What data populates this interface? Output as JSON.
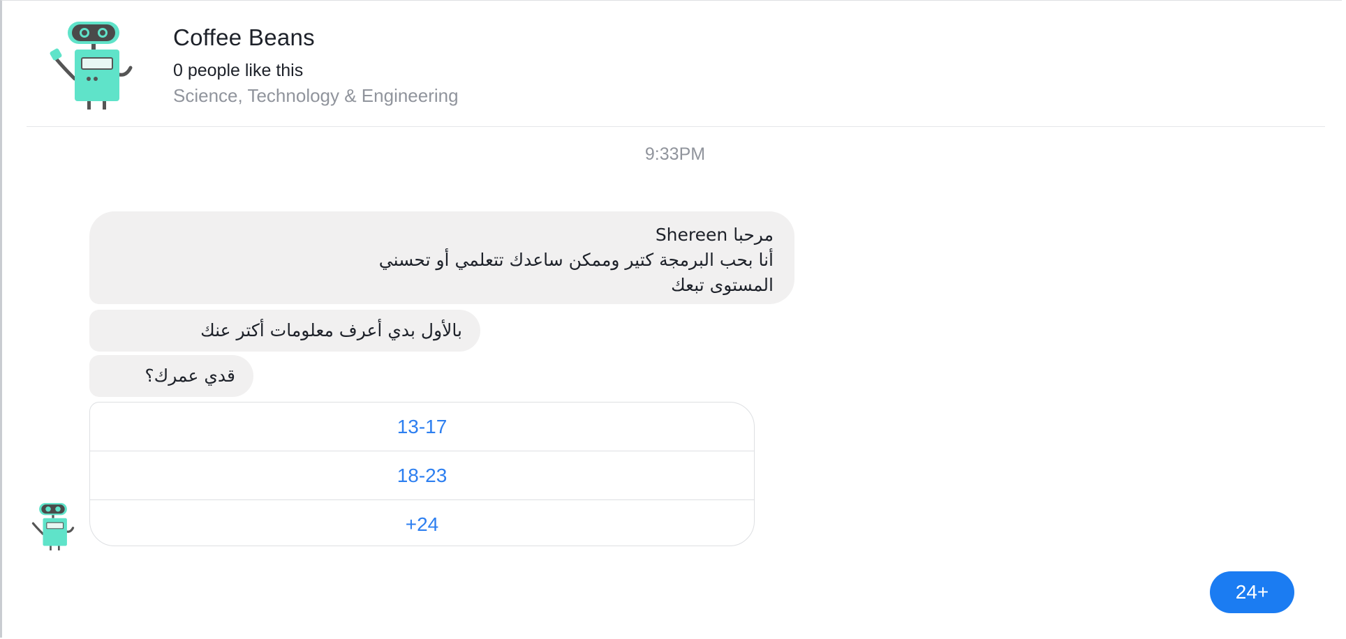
{
  "header": {
    "title": "Coffee Beans",
    "likes": "0 people like this",
    "category": "Science, Technology & Engineering",
    "avatar_icon": "robot-icon"
  },
  "conversation": {
    "timestamp": "9:33PM",
    "bot_messages": [
      {
        "lines": [
          "مرحبا Shereen",
          "أنا بحب البرمجة كتير وممكن ساعدك تتعلمي أو تحسني",
          "المستوى تبعك"
        ]
      },
      {
        "text": "بالأول بدي أعرف معلومات أكتر عنك"
      },
      {
        "text": "قدي عمرك؟"
      }
    ],
    "quick_replies": [
      "13-17",
      "18-23",
      "+24"
    ],
    "user_message": "24+"
  },
  "colors": {
    "bot_bubble": "#f1f0f0",
    "user_bubble": "#1b7cf2",
    "quick_reply_text": "#2d7ff0",
    "robot_body": "#5fe3c9",
    "robot_head": "#4a4a4a"
  }
}
